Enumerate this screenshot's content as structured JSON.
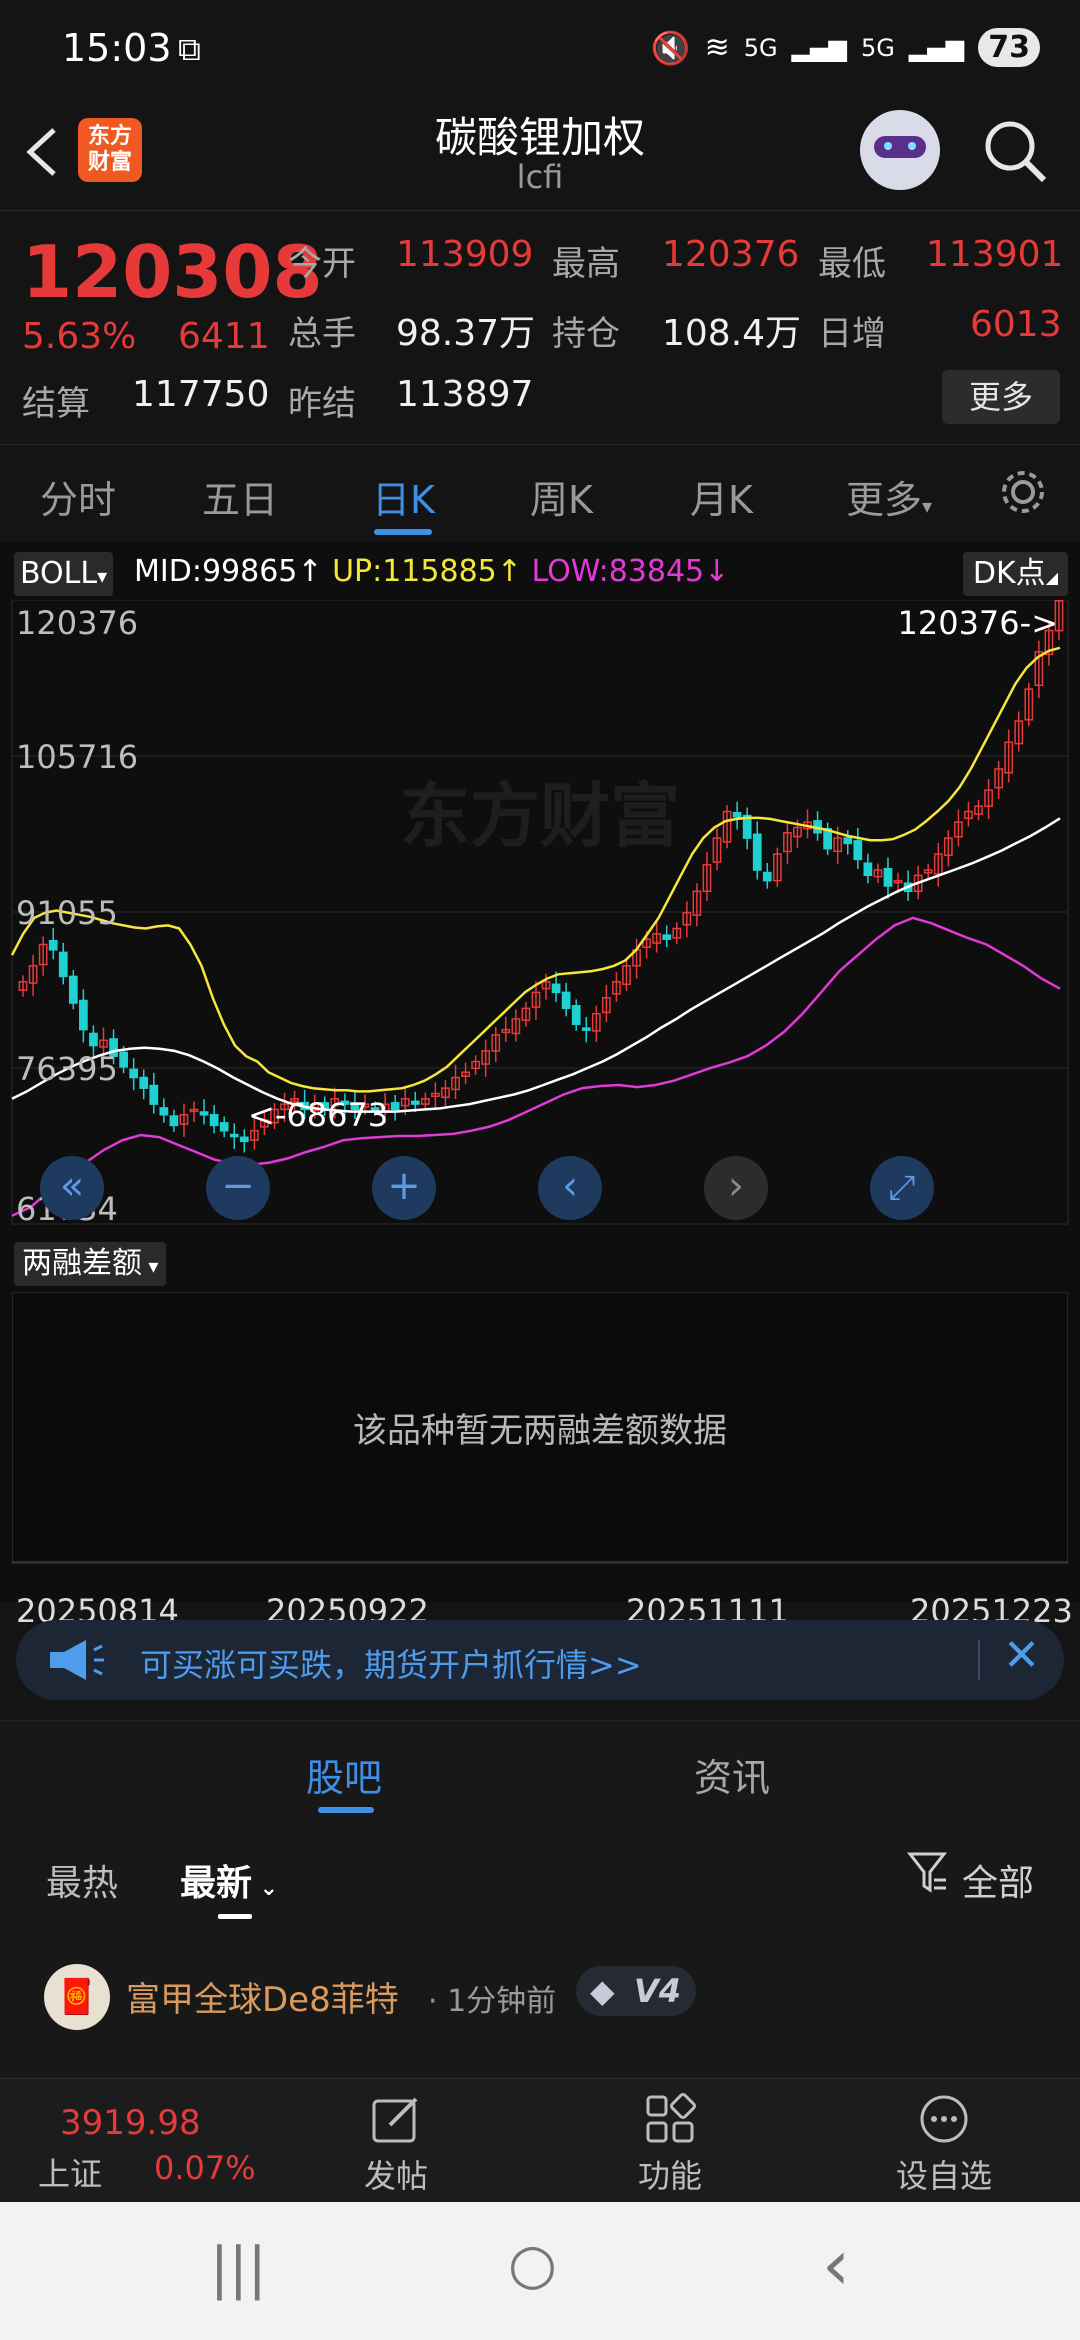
{
  "status_bar": {
    "time": "15:03",
    "battery": "73",
    "signal1": "5G",
    "signal2": "5G"
  },
  "header": {
    "logo_text": "东方\n财富",
    "title": "碳酸锂加权",
    "subtitle": "lcfi"
  },
  "quote": {
    "price": "120308",
    "change_pct": "5.63%",
    "change_amt": "6411",
    "fields": [
      {
        "label": "今开",
        "value": "113909",
        "color": "#e63a3a"
      },
      {
        "label": "最高",
        "value": "120376",
        "color": "#e63a3a"
      },
      {
        "label": "最低",
        "value": "113901",
        "color": "#e63a3a"
      },
      {
        "label": "总手",
        "value": "98.37万",
        "color": "#f0f0f0"
      },
      {
        "label": "持仓",
        "value": "108.4万",
        "color": "#f0f0f0"
      },
      {
        "label": "日增",
        "value": "6013",
        "color": "#e63a3a"
      },
      {
        "label": "结算",
        "value": "117750",
        "color": "#f0f0f0"
      },
      {
        "label": "昨结",
        "value": "113897",
        "color": "#f0f0f0"
      }
    ],
    "more_label": "更多"
  },
  "period_tabs": [
    "分时",
    "五日",
    "日K",
    "周K",
    "月K",
    "更多"
  ],
  "active_tab": "日K",
  "indicator": {
    "name": "BOLL",
    "mid": "MID:99865",
    "up": "UP:115885",
    "low": "LOW:83845",
    "dk": "DK点",
    "colors": {
      "mid": "#ffffff",
      "up": "#f5e63a",
      "low": "#e23ad8"
    }
  },
  "chart_data": {
    "type": "candlestick",
    "y_ticks": [
      "120376",
      "105716",
      "91055",
      "76395",
      "61734"
    ],
    "ylim": [
      61734,
      120376
    ],
    "max_label": "120376->",
    "min_label": "<-68673",
    "x_labels": [
      "20250814",
      "20250922",
      "20251111",
      "20251223"
    ],
    "watermark": "东方财富",
    "close_series": [
      84500,
      86000,
      88000,
      87500,
      85000,
      82500,
      80000,
      78500,
      79000,
      77500,
      76500,
      75500,
      74500,
      73000,
      72000,
      71000,
      72000,
      72500,
      72000,
      71000,
      70500,
      70000,
      69500,
      70500,
      71500,
      72500,
      73000,
      73500,
      72500,
      73000,
      72500,
      73500,
      73000,
      72500,
      73000,
      72500,
      73000,
      72500,
      73500,
      73000,
      73500,
      74000,
      74500,
      75500,
      76000,
      77000,
      78000,
      79500,
      80000,
      81000,
      82000,
      83500,
      84500,
      83500,
      82000,
      80500,
      80000,
      81500,
      83000,
      84500,
      86000,
      87500,
      88500,
      89000,
      88500,
      89500,
      91000,
      93000,
      95500,
      98000,
      100500,
      100000,
      98000,
      95000,
      94000,
      96500,
      98500,
      99000,
      99500,
      98500,
      97000,
      98000,
      97500,
      96000,
      94500,
      95000,
      93500,
      94000,
      93000,
      94500,
      95000,
      96500,
      98000,
      99500,
      100500,
      101000,
      102500,
      104500,
      107000,
      109000,
      112000,
      115500,
      117500,
      120308
    ],
    "boll_up": [
      87000,
      89000,
      90500,
      91000,
      91200,
      91000,
      90800,
      90600,
      90300,
      90000,
      89800,
      89600,
      89500,
      89700,
      89800,
      89500,
      88000,
      86000,
      83000,
      80500,
      78500,
      77500,
      77000,
      76000,
      75500,
      75000,
      74700,
      74500,
      74400,
      74300,
      74300,
      74200,
      74200,
      74300,
      74400,
      74500,
      74800,
      75200,
      75800,
      76500,
      77500,
      78500,
      79500,
      80500,
      81500,
      82500,
      83500,
      84200,
      84800,
      85200,
      85300,
      85400,
      85500,
      85700,
      86000,
      86500,
      87500,
      89000,
      90500,
      92500,
      94500,
      96500,
      98000,
      99000,
      99600,
      99800,
      99900,
      99900,
      99800,
      99600,
      99400,
      99200,
      99000,
      98800,
      98500,
      98200,
      98000,
      97800,
      97800,
      97900,
      98300,
      98800,
      99600,
      100500,
      101500,
      102800,
      104500,
      106500,
      108500,
      110500,
      112500,
      114000,
      115000,
      115600,
      115885
    ],
    "boll_mid": [
      73500,
      74200,
      75000,
      75800,
      76500,
      77100,
      77600,
      78000,
      78200,
      78300,
      78200,
      78000,
      77600,
      77000,
      76300,
      75500,
      74800,
      74100,
      73500,
      73000,
      72700,
      72500,
      72400,
      72300,
      72300,
      72300,
      72300,
      72400,
      72500,
      72600,
      72800,
      73000,
      73300,
      73600,
      73900,
      74300,
      74800,
      75300,
      75800,
      76400,
      77000,
      77700,
      78500,
      79300,
      80200,
      81000,
      81900,
      82700,
      83500,
      84300,
      85100,
      85900,
      86700,
      87500,
      88300,
      89100,
      90000,
      90800,
      91600,
      92300,
      93000,
      93600,
      94100,
      94600,
      95100,
      95600,
      96200,
      96800,
      97500,
      98200,
      99000,
      99865
    ],
    "boll_low": [
      62500,
      63300,
      64800,
      66300,
      67500,
      68700,
      69600,
      70100,
      69900,
      69200,
      68500,
      67800,
      67400,
      67300,
      67500,
      67900,
      68500,
      69000,
      69600,
      69800,
      69900,
      70000,
      70000,
      70100,
      70200,
      70500,
      70900,
      71500,
      72300,
      73100,
      73900,
      74500,
      74700,
      74800,
      74600,
      74800,
      75200,
      75800,
      76400,
      76900,
      77500,
      78500,
      79800,
      81500,
      83500,
      85500,
      87000,
      88500,
      89800,
      90500,
      90000,
      89300,
      88600,
      88000,
      87000,
      86000,
      84800,
      83845
    ]
  },
  "controls": [
    "«",
    "−",
    "+",
    "‹",
    "›",
    "⤢"
  ],
  "sub_indicator": {
    "name": "两融差额",
    "empty_text": "该品种暂无两融差额数据"
  },
  "banner": {
    "text": "可买涨可买跌，期货开户抓行情>>",
    "close": "✕"
  },
  "community_tabs": [
    "股吧",
    "资讯"
  ],
  "filters": {
    "hot": "最热",
    "latest": "最新",
    "all": "全部"
  },
  "post": {
    "author": "富甲全球De8菲特",
    "time": "· 1分钟前",
    "level": "V4"
  },
  "bottom_bar": {
    "index_value": "3919.98",
    "index_name": "上证",
    "index_change": "0.07%",
    "items": [
      "发帖",
      "功能",
      "设自选"
    ]
  },
  "nav": {
    "recent": "|||",
    "home": "○",
    "back": "‹"
  }
}
